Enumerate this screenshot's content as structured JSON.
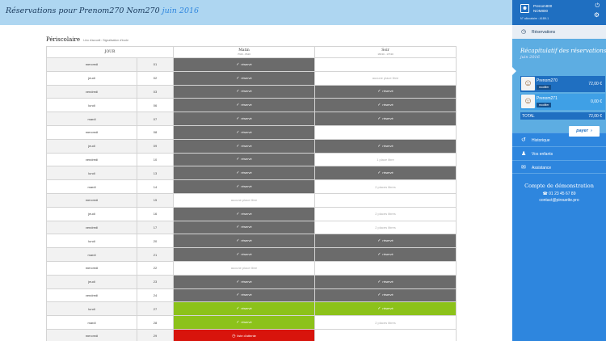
{
  "header": {
    "title_prefix": "Réservations pour Prenom270 Nom270",
    "month": "juin 2016"
  },
  "section": {
    "title": "Périscolaire",
    "subtitle": "Lieu d'accueil : Signalisation d'école"
  },
  "table": {
    "col_day": "JOUR",
    "col_matin": "Matin",
    "col_matin_hours": "7h00 - 8h20",
    "col_soir": "Soir",
    "col_soir_hours": "16h30 - 17h30",
    "rows": [
      {
        "day": "mercredi",
        "num": "01",
        "matin": {
          "type": "reserve",
          "text": "réservé"
        },
        "soir": {
          "type": "free",
          "text": ""
        }
      },
      {
        "day": "jeudi",
        "num": "02",
        "matin": {
          "type": "reserve",
          "text": "réservé"
        },
        "soir": {
          "type": "free",
          "text": "aucune place libre"
        }
      },
      {
        "day": "vendredi",
        "num": "03",
        "matin": {
          "type": "reserve",
          "text": "réservé"
        },
        "soir": {
          "type": "reserve",
          "text": "réservé"
        }
      },
      {
        "day": "lundi",
        "num": "06",
        "matin": {
          "type": "reserve",
          "text": "réservé"
        },
        "soir": {
          "type": "reserve",
          "text": "réservé"
        }
      },
      {
        "day": "mardi",
        "num": "07",
        "matin": {
          "type": "reserve",
          "text": "réservé"
        },
        "soir": {
          "type": "reserve",
          "text": "réservé"
        }
      },
      {
        "day": "mercredi",
        "num": "08",
        "matin": {
          "type": "reserve",
          "text": "réservé"
        },
        "soir": {
          "type": "free",
          "text": ""
        }
      },
      {
        "day": "jeudi",
        "num": "09",
        "matin": {
          "type": "reserve",
          "text": "réservé"
        },
        "soir": {
          "type": "reserve",
          "text": "réservé"
        }
      },
      {
        "day": "vendredi",
        "num": "10",
        "matin": {
          "type": "reserve",
          "text": "réservé"
        },
        "soir": {
          "type": "free",
          "text": "1 place libre"
        }
      },
      {
        "day": "lundi",
        "num": "13",
        "matin": {
          "type": "reserve",
          "text": "réservé"
        },
        "soir": {
          "type": "reserve",
          "text": "réservé"
        }
      },
      {
        "day": "mardi",
        "num": "14",
        "matin": {
          "type": "reserve",
          "text": "réservé"
        },
        "soir": {
          "type": "free",
          "text": "2 places libres"
        }
      },
      {
        "day": "mercredi",
        "num": "15",
        "matin": {
          "type": "free",
          "text": "aucune place libre"
        },
        "soir": {
          "type": "free",
          "text": ""
        }
      },
      {
        "day": "jeudi",
        "num": "16",
        "matin": {
          "type": "reserve",
          "text": "réservé"
        },
        "soir": {
          "type": "free",
          "text": "2 places libres"
        }
      },
      {
        "day": "vendredi",
        "num": "17",
        "matin": {
          "type": "reserve",
          "text": "réservé"
        },
        "soir": {
          "type": "free",
          "text": "2 places libres"
        }
      },
      {
        "day": "lundi",
        "num": "20",
        "matin": {
          "type": "reserve",
          "text": "réservé"
        },
        "soir": {
          "type": "reserve",
          "text": "réservé"
        }
      },
      {
        "day": "mardi",
        "num": "21",
        "matin": {
          "type": "reserve",
          "text": "réservé"
        },
        "soir": {
          "type": "reserve",
          "text": "réservé"
        }
      },
      {
        "day": "mercredi",
        "num": "22",
        "matin": {
          "type": "free",
          "text": "aucune place libre"
        },
        "soir": {
          "type": "free",
          "text": ""
        }
      },
      {
        "day": "jeudi",
        "num": "23",
        "matin": {
          "type": "reserve",
          "text": "réservé"
        },
        "soir": {
          "type": "reserve",
          "text": "réservé"
        }
      },
      {
        "day": "vendredi",
        "num": "24",
        "matin": {
          "type": "reserve",
          "text": "réservé"
        },
        "soir": {
          "type": "reserve",
          "text": "réservé"
        }
      },
      {
        "day": "lundi",
        "num": "27",
        "matin": {
          "type": "green",
          "text": "réservé"
        },
        "soir": {
          "type": "green",
          "text": "réservé"
        }
      },
      {
        "day": "mardi",
        "num": "28",
        "matin": {
          "type": "green",
          "text": "réservé"
        },
        "soir": {
          "type": "free",
          "text": "2 places libres"
        }
      },
      {
        "day": "mercredi",
        "num": "29",
        "matin": {
          "type": "red",
          "text": "liste d'attente"
        },
        "soir": {
          "type": "free",
          "text": ""
        }
      }
    ]
  },
  "sidebar": {
    "user_line1": "Prenom800",
    "user_line2": "NOM800",
    "user_id": "N° allocataire : A1B9-1",
    "nav_active": "Réservations",
    "recap_title": "Récapitulatif des réservations",
    "recap_month": "juin 2016",
    "children": [
      {
        "name": "Prenom270",
        "modify": "modifier",
        "amount": "72,00 €"
      },
      {
        "name": "Prenom271",
        "modify": "modifier",
        "amount": "0,00 €"
      }
    ],
    "total_label": "TOTAL",
    "total_value": "72,00 €",
    "pay_label": "payer",
    "nav_items": [
      {
        "label": "Historique",
        "icon": "history-icon"
      },
      {
        "label": "Vos enfants",
        "icon": "children-icon"
      },
      {
        "label": "Assistance",
        "icon": "chat-icon"
      }
    ],
    "demo_title": "Compte de démonstration",
    "demo_phone": "01 23 45 67 89",
    "demo_email": "contact@pirouette.pro"
  },
  "colors": {
    "reserve": "#6b6b6b",
    "green": "#8cc21a",
    "red": "#d8140c",
    "sidebar": "#2e86de"
  }
}
